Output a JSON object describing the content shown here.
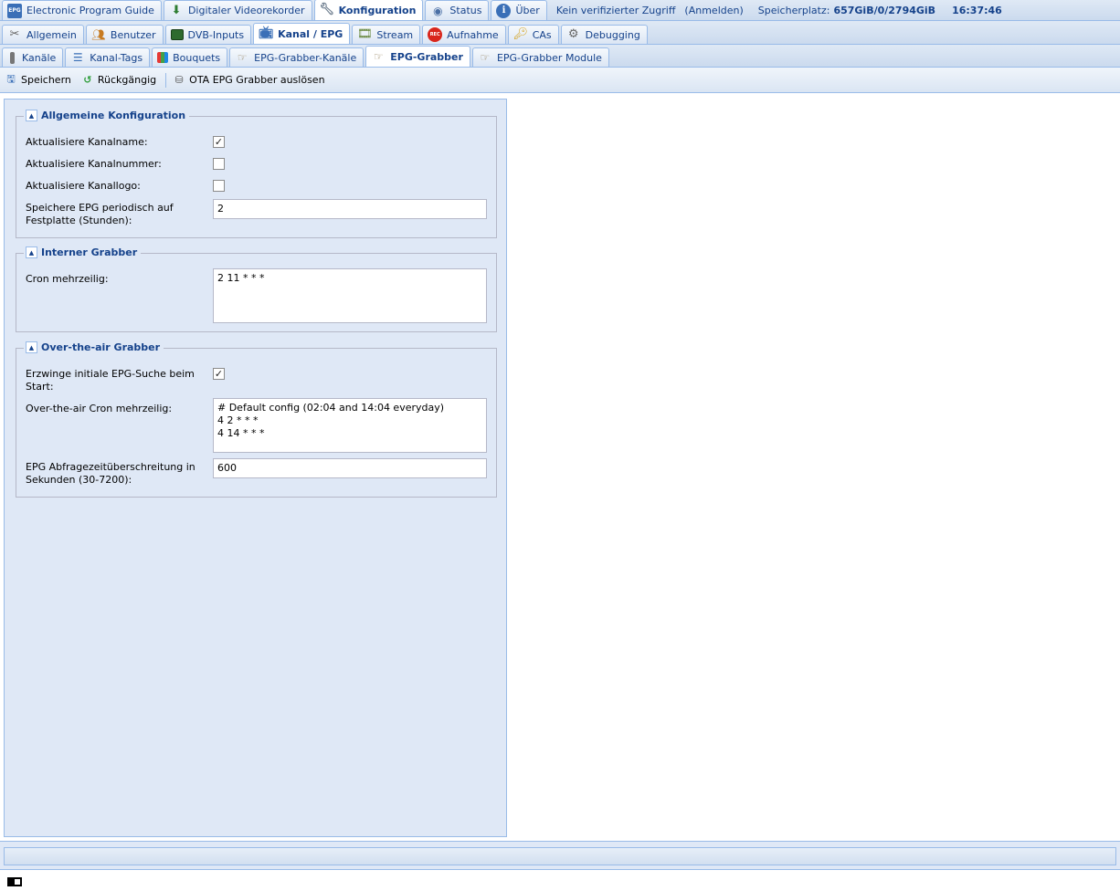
{
  "top_tabs": [
    {
      "label": "Electronic Program Guide",
      "icon": "epg-icon",
      "active": false
    },
    {
      "label": "Digitaler Videorekorder",
      "icon": "download-icon",
      "active": false
    },
    {
      "label": "Konfiguration",
      "icon": "wrench-icon",
      "active": true
    },
    {
      "label": "Status",
      "icon": "eye-icon",
      "active": false
    },
    {
      "label": "Über",
      "icon": "info-icon",
      "active": false
    }
  ],
  "top_info": {
    "access": "Kein verifizierter Zugriff",
    "login": "(Anmelden)",
    "storage_label": "Speicherplatz:",
    "storage_value": "657GiB/0/2794GiB",
    "time": "16:37:46"
  },
  "config_tabs": [
    {
      "label": "Allgemein",
      "icon": "tools-icon"
    },
    {
      "label": "Benutzer",
      "icon": "users-icon"
    },
    {
      "label": "DVB-Inputs",
      "icon": "card-icon"
    },
    {
      "label": "Kanal / EPG",
      "icon": "tv-icon"
    },
    {
      "label": "Stream",
      "icon": "stream-icon"
    },
    {
      "label": "Aufnahme",
      "icon": "rec-icon"
    },
    {
      "label": "CAs",
      "icon": "key-icon"
    },
    {
      "label": "Debugging",
      "icon": "bug-icon"
    }
  ],
  "channel_tabs": [
    {
      "label": "Kanäle",
      "icon": "remote-icon"
    },
    {
      "label": "Kanal-Tags",
      "icon": "tree-icon"
    },
    {
      "label": "Bouquets",
      "icon": "grid-icon"
    },
    {
      "label": "EPG-Grabber-Kanäle",
      "icon": "grabber-icon"
    },
    {
      "label": "EPG-Grabber",
      "icon": "grabber-icon"
    },
    {
      "label": "EPG-Grabber Module",
      "icon": "grabber-icon"
    }
  ],
  "toolbar": {
    "save": "Speichern",
    "undo": "Rückgängig",
    "ota_trigger": "OTA EPG Grabber auslösen"
  },
  "general": {
    "title": "Allgemeine Konfiguration",
    "update_name_label": "Aktualisiere Kanalname:",
    "update_name_checked": true,
    "update_number_label": "Aktualisiere Kanalnummer:",
    "update_number_checked": false,
    "update_logo_label": "Aktualisiere Kanallogo:",
    "update_logo_checked": false,
    "save_period_label": "Speichere EPG periodisch auf Festplatte (Stunden):",
    "save_period_value": "2"
  },
  "internal": {
    "title": "Interner Grabber",
    "cron_label": "Cron mehrzeilig:",
    "cron_value": "2 11 * * *"
  },
  "ota": {
    "title": "Over-the-air Grabber",
    "force_label": "Erzwinge initiale EPG-Suche beim Start:",
    "force_checked": true,
    "cron_label": "Over-the-air Cron mehrzeilig:",
    "cron_value": "# Default config (02:04 and 14:04 everyday)\n4 2 * * *\n4 14 * * *",
    "timeout_label": "EPG Abfragezeitüberschreitung in Sekunden (30-7200):",
    "timeout_value": "600"
  }
}
